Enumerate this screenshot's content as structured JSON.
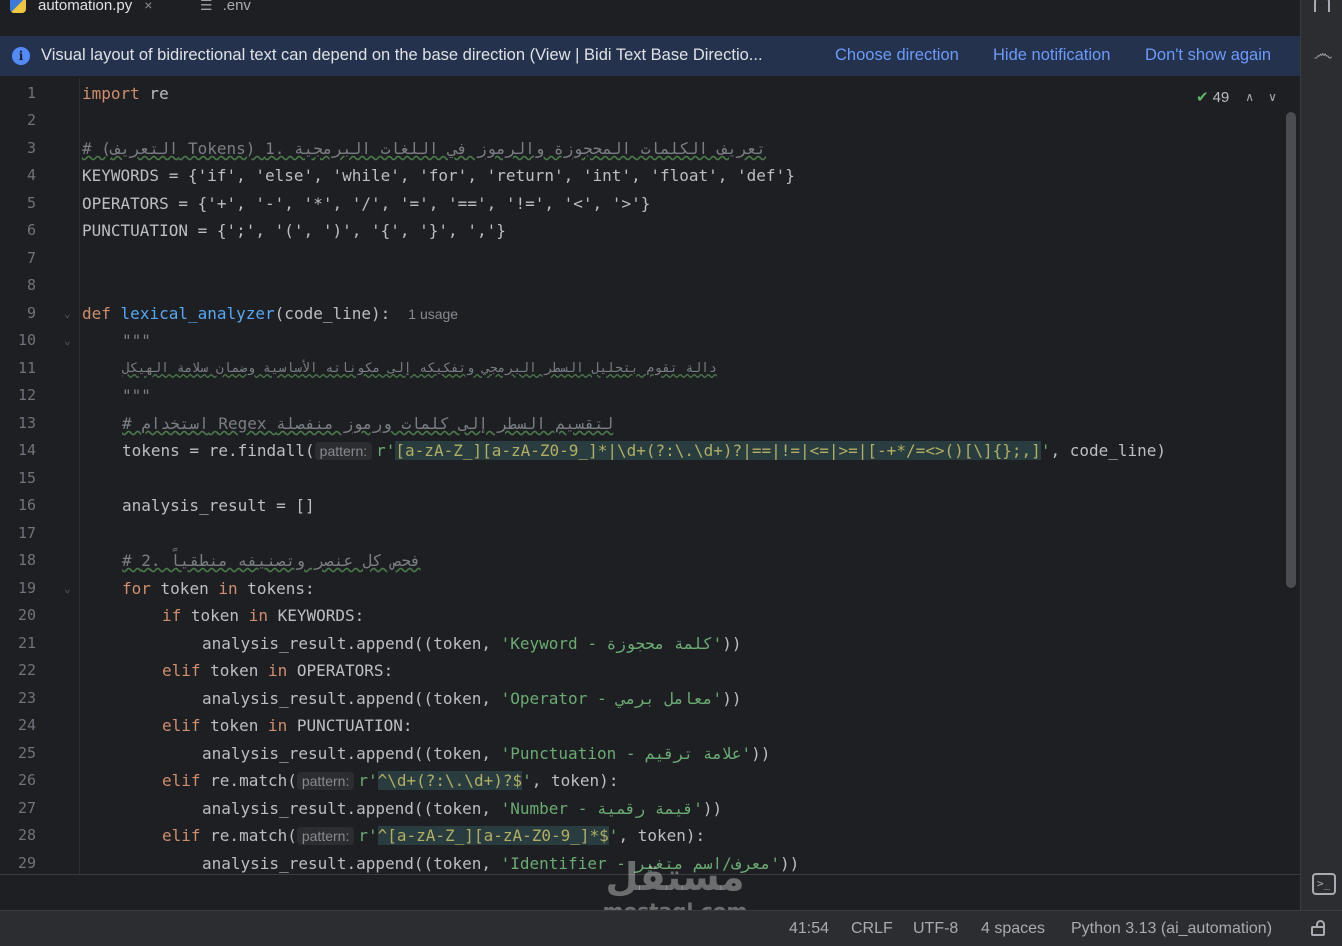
{
  "tabs": [
    {
      "label": "automation.py",
      "active": true,
      "close": "×"
    },
    {
      "label": ".env",
      "active": false
    }
  ],
  "notification": {
    "info": "i",
    "text": "Visual layout of bidirectional text can depend on the base direction (View | Bidi Text Base Directio...",
    "links": [
      "Choose direction",
      "Hide notification",
      "Don't show again"
    ]
  },
  "inspection": {
    "count": "49",
    "up": "⌃",
    "down": "⌄"
  },
  "code": {
    "l1": [
      "import",
      " re"
    ],
    "l3": "# (التعريف Tokens) تعريف الكلمات المحجوزة والرموز في اللغات البرمجية .1",
    "l4": "KEYWORDS = {'if', 'else', 'while', 'for', 'return', 'int', 'float', 'def'}",
    "l5": "OPERATORS = {'+', '-', '*', '/', '=', '==', '!=', '<', '>'}",
    "l6": "PUNCTUATION = {';', '(', ')', '{', '}', ','}",
    "l9": {
      "kw": "def",
      "fn": "lexical_analyzer",
      "rest": "(code_line):",
      "usage": "1 usage"
    },
    "l10": "\"\"\"",
    "l11": "دالة تقوم بتحليل السطر البرمجي وتفكيكه إلى مكوناته الأساسية وضمان سلامة الهيكل",
    "l12": "\"\"\"",
    "l13": "# استخدام Regex لتقسيم السطر إلى كلمات ورموز منفصلة",
    "l14": {
      "a": "tokens = re.findall(",
      "hint": "pattern:",
      "b": "r'",
      "rx": "[a-zA-Z_][a-zA-Z0-9_]*|\\d+(?:\\.\\d+)?|==|!=|<=|>=|[-+*/=<>()[\\]{};,]",
      "c": "'",
      "d": ", code_line)"
    },
    "l16": "analysis_result = []",
    "l18": "# فحص كل عنصر وتصنيفه منطقياً .2",
    "l19": {
      "kw1": "for",
      "a": " token ",
      "kw2": "in",
      "b": " tokens:"
    },
    "l20": {
      "kw1": "if",
      "a": " token ",
      "kw2": "in",
      "b": " KEYWORDS:"
    },
    "l21": {
      "a": "analysis_result.append((token, ",
      "s": "'Keyword - كلمة محجوزة'",
      "b": "))"
    },
    "l22": {
      "kw1": "elif",
      "a": " token ",
      "kw2": "in",
      "b": " OPERATORS:"
    },
    "l23": {
      "a": "analysis_result.append((token, ",
      "s": "'Operator - معامل برمي'",
      "b": "))"
    },
    "l24": {
      "kw1": "elif",
      "a": " token ",
      "kw2": "in",
      "b": " PUNCTUATION:"
    },
    "l25": {
      "a": "analysis_result.append((token, ",
      "s": "'Punctuation - علامة ترقيم'",
      "b": "))"
    },
    "l26": {
      "kw": "elif",
      "a": " re.match(",
      "hint": "pattern:",
      "b": "r'",
      "rx": "^\\d+(?:\\.\\d+)?$",
      "c": "'",
      "d": ", token):"
    },
    "l27": {
      "a": "analysis_result.append((token, ",
      "s": "'Number - قيمة رقمية'",
      "b": "))"
    },
    "l28": {
      "kw": "elif",
      "a": " re.match(",
      "hint": "pattern:",
      "b": "r'",
      "rx": "^[a-zA-Z_][a-zA-Z0-9_]*$",
      "c": "'",
      "d": ", token):"
    },
    "l29": {
      "a": "analysis_result.append((token, ",
      "s": "'Identifier - معرف/اسم متغير'",
      "b": "))"
    }
  },
  "watermark": {
    "ar": "مستقل",
    "en": "mostaql.com"
  },
  "status": {
    "position": "41:54",
    "line_sep": "CRLF",
    "encoding": "UTF-8",
    "indent": "4 spaces",
    "interpreter": "Python 3.13 (ai_automation)"
  },
  "colors": {
    "keyword": "#cf8e6d",
    "function": "#56a8f5",
    "string": "#6aab73",
    "comment": "#7a7e85",
    "link": "#6b9bfa"
  }
}
